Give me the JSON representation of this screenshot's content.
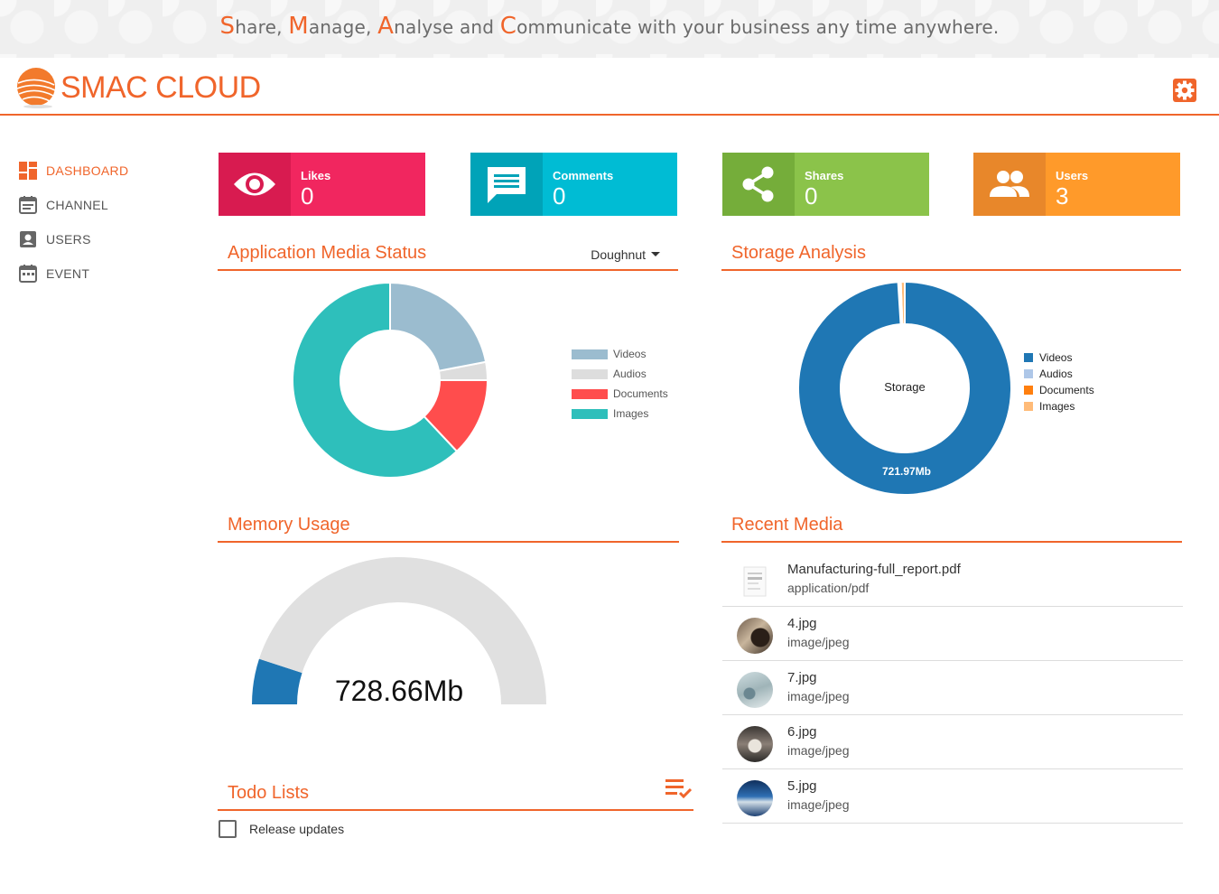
{
  "banner": {
    "parts": [
      {
        "cap": "S",
        "rest": "hare, "
      },
      {
        "cap": "M",
        "rest": "anage, "
      },
      {
        "cap": "A",
        "rest": "nalyse and "
      },
      {
        "cap": "C",
        "rest": "ommunicate with your business any time anywhere."
      }
    ]
  },
  "header": {
    "brand": "SMAC CLOUD",
    "settings_icon": "settings-gear-icon"
  },
  "colors": {
    "accent": "#f0652b",
    "likes": "#f1265f",
    "comments": "#00bcd4",
    "shares": "#8bc34a",
    "users": "#ff9a2a"
  },
  "sidebar": {
    "items": [
      {
        "label": "DASHBOARD",
        "icon": "dashboard-icon",
        "active": true
      },
      {
        "label": "CHANNEL",
        "icon": "channel-icon",
        "active": false
      },
      {
        "label": "USERS",
        "icon": "users-icon",
        "active": false
      },
      {
        "label": "EVENT",
        "icon": "event-icon",
        "active": false
      }
    ]
  },
  "stats": {
    "likes": {
      "label": "Likes",
      "value": "0",
      "icon": "eye-icon"
    },
    "comments": {
      "label": "Comments",
      "value": "0",
      "icon": "comment-icon"
    },
    "shares": {
      "label": "Shares",
      "value": "0",
      "icon": "share-icon"
    },
    "users": {
      "label": "Users",
      "value": "3",
      "icon": "group-icon"
    }
  },
  "media_status": {
    "title": "Application Media Status",
    "chart_type_label": "Doughnut"
  },
  "storage": {
    "title": "Storage Analysis",
    "center_label": "Storage",
    "value_label": "721.97Mb"
  },
  "memory": {
    "title": "Memory Usage",
    "value_label": "728.66Mb"
  },
  "recent_media": {
    "title": "Recent Media",
    "items": [
      {
        "name": "Manufacturing-full_report.pdf",
        "type": "application/pdf"
      },
      {
        "name": "4.jpg",
        "type": "image/jpeg"
      },
      {
        "name": "7.jpg",
        "type": "image/jpeg"
      },
      {
        "name": "6.jpg",
        "type": "image/jpeg"
      },
      {
        "name": "5.jpg",
        "type": "image/jpeg"
      }
    ]
  },
  "todo": {
    "title": "Todo Lists",
    "items": [
      {
        "label": "Release updates",
        "checked": false
      }
    ]
  },
  "chart_data": [
    {
      "type": "pie",
      "variant": "doughnut",
      "labels": [
        "Videos",
        "Audios",
        "Documents",
        "Images"
      ],
      "values": [
        22,
        3,
        13,
        62
      ],
      "colors": [
        "#9bbccf",
        "#dddddd",
        "#ff4d4d",
        "#2ebfbb"
      ],
      "legend": "right"
    },
    {
      "type": "pie",
      "variant": "doughnut",
      "labels": [
        "Videos",
        "Audios",
        "Documents",
        "Images"
      ],
      "values": [
        99.0,
        0.2,
        0.2,
        0.6
      ],
      "colors": [
        "#1f77b4",
        "#aec7e8",
        "#ff7f0e",
        "#ffbb78"
      ],
      "legend": "right"
    },
    {
      "type": "gauge",
      "value_label": "728.66Mb",
      "fraction": 0.1,
      "colors": [
        "#1f77b4",
        "#e0e0e0"
      ]
    }
  ]
}
